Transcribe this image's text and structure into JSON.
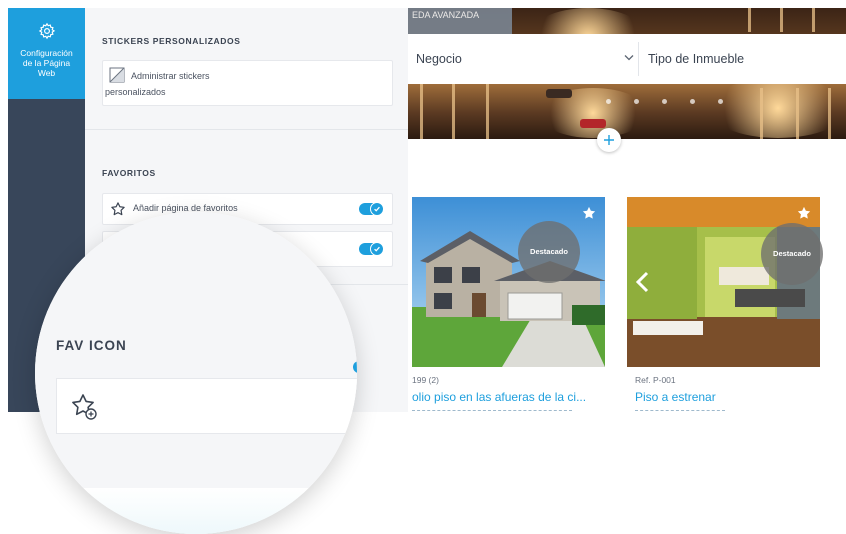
{
  "sidebar": {
    "active_item": {
      "icon": "gear-icon",
      "label_lines": [
        "Configuración",
        "de la Página",
        "Web"
      ]
    }
  },
  "panel": {
    "stickers": {
      "title": "STICKERS PERSONALIZADOS",
      "item_label_line1": "Administrar stickers",
      "item_label_line2": "personalizados"
    },
    "favoritos": {
      "title": "FAVORITOS",
      "item1_label": "Añadir página de favoritos"
    }
  },
  "site": {
    "hero_tab": "EDA AVANZADA",
    "search": {
      "business_select": "Negocio",
      "type_select": "Tipo de Inmueble"
    },
    "listings": [
      {
        "badge": "Destacado",
        "ref": "199 (2)",
        "title": "olio piso en las afueras de la ci..."
      },
      {
        "badge": "Destacado",
        "ref": "Ref. P-001",
        "title": "Piso a estrenar"
      }
    ]
  },
  "magnifier": {
    "section_title": "FAV ICON"
  },
  "colors": {
    "accent": "#1e9fdd",
    "sidebar_bg": "#38465a",
    "panel_bg": "#f5f6f8",
    "text_dark": "#3b4452"
  }
}
